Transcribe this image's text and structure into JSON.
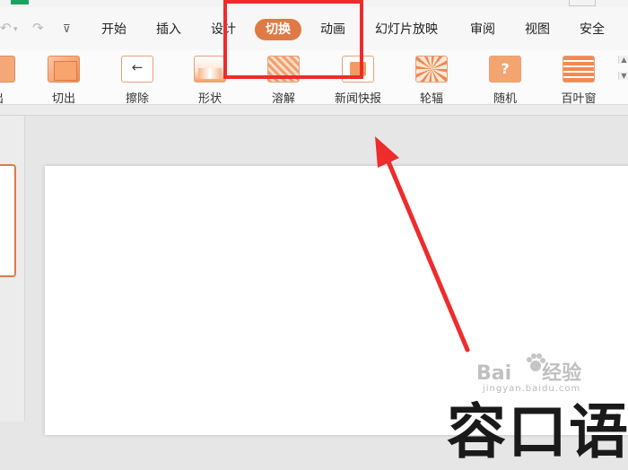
{
  "quick_access": {
    "undo": "↶",
    "undo_dropdown": "▾",
    "redo": "↷",
    "customize": "⊽"
  },
  "ribbon": {
    "tabs": [
      {
        "label": "开始",
        "active": false
      },
      {
        "label": "插入",
        "active": false
      },
      {
        "label": "设计",
        "active": false
      },
      {
        "label": "切换",
        "active": true
      },
      {
        "label": "动画",
        "active": false
      },
      {
        "label": "幻灯片放映",
        "active": false
      },
      {
        "label": "审阅",
        "active": false
      },
      {
        "label": "视图",
        "active": false
      },
      {
        "label": "安全",
        "active": false
      }
    ],
    "transitions": [
      {
        "label": "出",
        "icon": "partial-transition-icon"
      },
      {
        "label": "切出",
        "icon": "cut-out-icon"
      },
      {
        "label": "擦除",
        "icon": "wipe-icon"
      },
      {
        "label": "形状",
        "icon": "shape-icon"
      },
      {
        "label": "溶解",
        "icon": "dissolve-icon"
      },
      {
        "label": "新闻快报",
        "icon": "newsflash-icon"
      },
      {
        "label": "轮辐",
        "icon": "wheel-icon"
      },
      {
        "label": "随机",
        "icon": "random-icon",
        "glyph": "?"
      },
      {
        "label": "百叶窗",
        "icon": "blinds-icon"
      }
    ],
    "scroll_up": "▲",
    "scroll_down": "▼"
  },
  "slide": {
    "visible_text": "容口语"
  },
  "watermark": {
    "brand": "Bai",
    "brand2": "经验",
    "url": "jingyan.baidu.com"
  },
  "colors": {
    "accent": "#e07a45",
    "highlight": "#ee2c2c"
  }
}
